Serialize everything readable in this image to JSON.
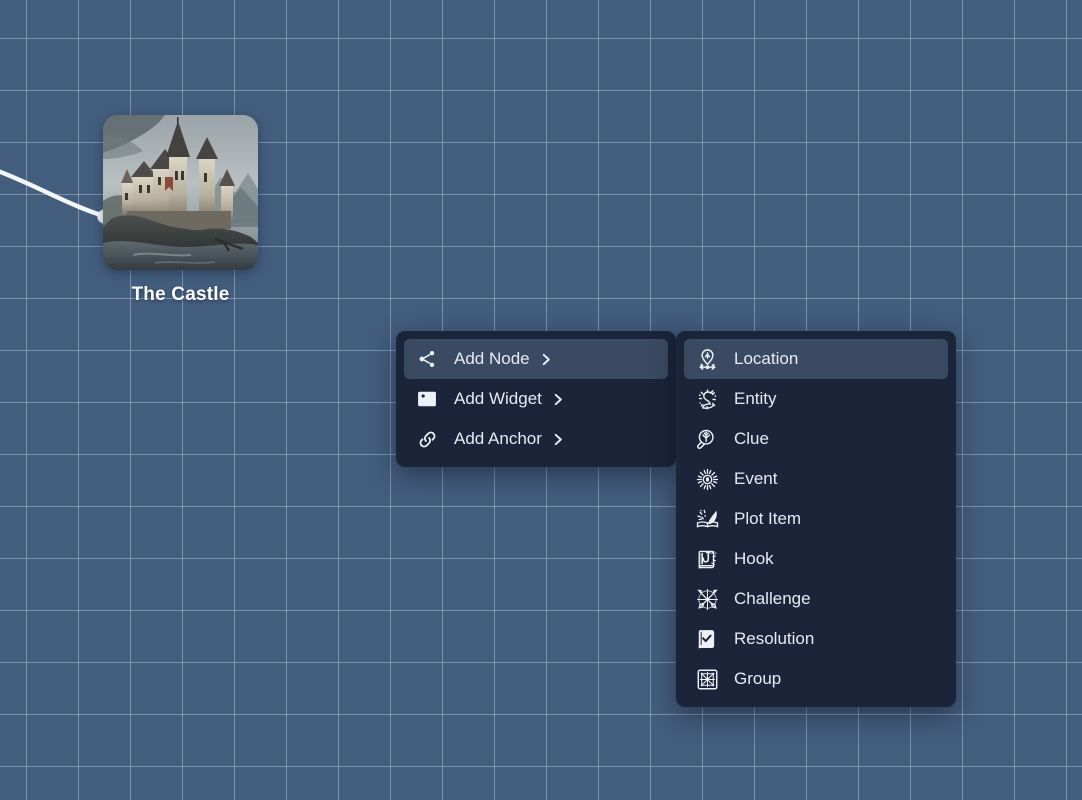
{
  "canvas": {
    "background_color": "#435d7d",
    "grid_line_color": "#cbdaeb",
    "grid_size": 52
  },
  "node": {
    "label": "The Castle",
    "image_alt": "castle-thumbnail",
    "handle_name": "edge-handle"
  },
  "context_menu": {
    "background_color": "#1b2438",
    "highlight_color": "#3b4a63",
    "text_color": "#e6eaf3",
    "items": [
      {
        "label": "Add Node",
        "icon": "share-nodes-icon",
        "has_submenu": true,
        "active": true
      },
      {
        "label": "Add Widget",
        "icon": "image-icon",
        "has_submenu": true,
        "active": false
      },
      {
        "label": "Add Anchor",
        "icon": "link-icon",
        "has_submenu": true,
        "active": false
      }
    ],
    "submenu_arrow": "chevron-right-icon"
  },
  "submenu": {
    "items": [
      {
        "label": "Location",
        "icon": "location-pin-icon",
        "active": true
      },
      {
        "label": "Entity",
        "icon": "creature-icon",
        "active": false
      },
      {
        "label": "Clue",
        "icon": "magnifier-icon",
        "active": false
      },
      {
        "label": "Event",
        "icon": "starburst-eye-icon",
        "active": false
      },
      {
        "label": "Plot Item",
        "icon": "quill-book-icon",
        "active": false
      },
      {
        "label": "Hook",
        "icon": "hook-book-icon",
        "active": false
      },
      {
        "label": "Challenge",
        "icon": "crossed-swords-icon",
        "active": false
      },
      {
        "label": "Resolution",
        "icon": "check-book-icon",
        "active": false
      },
      {
        "label": "Group",
        "icon": "group-frame-icon",
        "active": false
      }
    ]
  }
}
